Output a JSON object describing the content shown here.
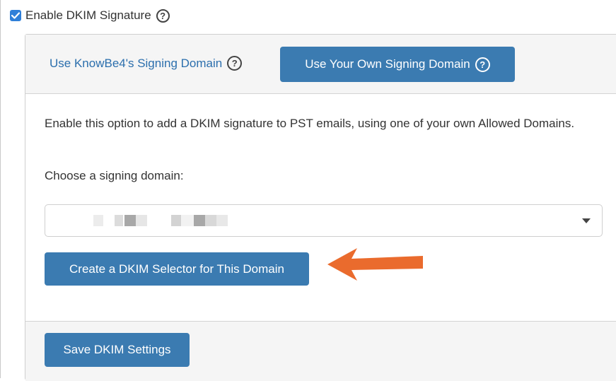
{
  "dkim": {
    "enable_label": "Enable DKIM Signature",
    "enable_checked": true
  },
  "tabs": {
    "knowbe4_label": "Use KnowBe4's Signing Domain",
    "own_label": "Use Your Own Signing Domain",
    "active": "own"
  },
  "help_glyph": "?",
  "content": {
    "description": "Enable this option to add a DKIM signature to PST emails, using one of your own Allowed Domains.",
    "choose_label": "Choose a signing domain:",
    "domain_select_value": "",
    "create_selector_label": "Create a DKIM Selector for This Domain"
  },
  "footer": {
    "save_label": "Save DKIM Settings"
  },
  "colors": {
    "button_blue": "#3b7bb1",
    "link_blue": "#2c6fad",
    "checkbox_blue": "#2f7fd8",
    "annotation_arrow": "#ea6b2d"
  },
  "icons": [
    "check-icon",
    "help-circle-icon",
    "chevron-down-icon",
    "annotation-arrow-icon"
  ]
}
